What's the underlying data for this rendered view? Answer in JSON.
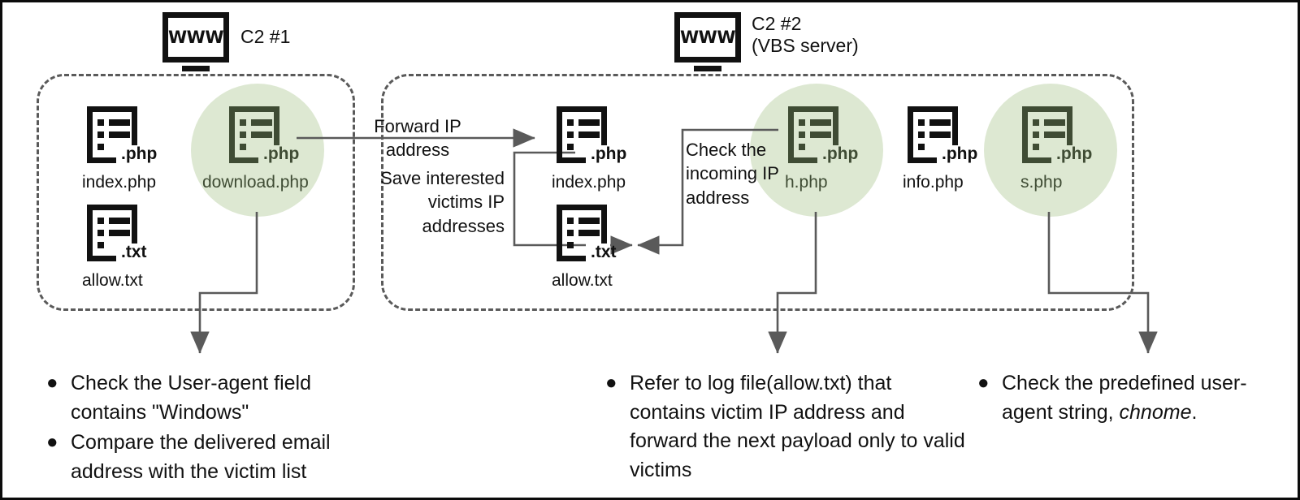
{
  "diagram": {
    "title": "C2 infrastructure flow",
    "colors": {
      "halo_green": "#dde8d2",
      "icon_green": "#3f4c34",
      "ink": "#111111",
      "wire_gray": "#5a5a5a"
    }
  },
  "servers": [
    {
      "id": "c2-1",
      "icon": "www-monitor-icon",
      "badge": "WWW",
      "label": "C2 #1"
    },
    {
      "id": "c2-2",
      "icon": "www-monitor-icon",
      "badge": "WWW",
      "label": "C2 #2\n(VBS server)"
    }
  ],
  "groups": [
    {
      "id": "group-c2-1",
      "name": "c2-1-boundary"
    },
    {
      "id": "group-c2-2",
      "name": "c2-2-boundary"
    }
  ],
  "files": [
    {
      "id": "f-index-1",
      "ext": ".php",
      "name": "index.php",
      "highlighted": false
    },
    {
      "id": "f-allow-1",
      "ext": ".txt",
      "name": "allow.txt",
      "highlighted": false
    },
    {
      "id": "f-download",
      "ext": ".php",
      "name": "download.php",
      "highlighted": true
    },
    {
      "id": "f-index-2",
      "ext": ".php",
      "name": "index.php",
      "highlighted": false
    },
    {
      "id": "f-allow-2",
      "ext": ".txt",
      "name": "allow.txt",
      "highlighted": false
    },
    {
      "id": "f-h",
      "ext": ".php",
      "name": "h.php",
      "highlighted": true
    },
    {
      "id": "f-info",
      "ext": ".php",
      "name": "info.php",
      "highlighted": false
    },
    {
      "id": "f-s",
      "ext": ".php",
      "name": "s.php",
      "highlighted": true
    }
  ],
  "edge_labels": {
    "forward_ip": "Forward IP address",
    "save_victims": "Save interested\nvictims IP\naddresses",
    "check_incoming": "Check the\nincoming IP\naddress"
  },
  "notes": [
    {
      "id": "notes-download",
      "items": [
        {
          "bullet": "●",
          "text": "Check the User-agent field contains \"Windows\""
        },
        {
          "bullet": "●",
          "text": "Compare the delivered email address with the victim list"
        }
      ]
    },
    {
      "id": "notes-h",
      "items": [
        {
          "bullet": "●",
          "text": "Refer to log file(allow.txt) that contains victim IP address and forward the next payload only to valid victims"
        }
      ]
    },
    {
      "id": "notes-s",
      "items": [
        {
          "bullet": "●",
          "text_pre": "Check the predefined user-agent string, ",
          "text_em": "chnome",
          "text_post": "."
        }
      ]
    }
  ]
}
